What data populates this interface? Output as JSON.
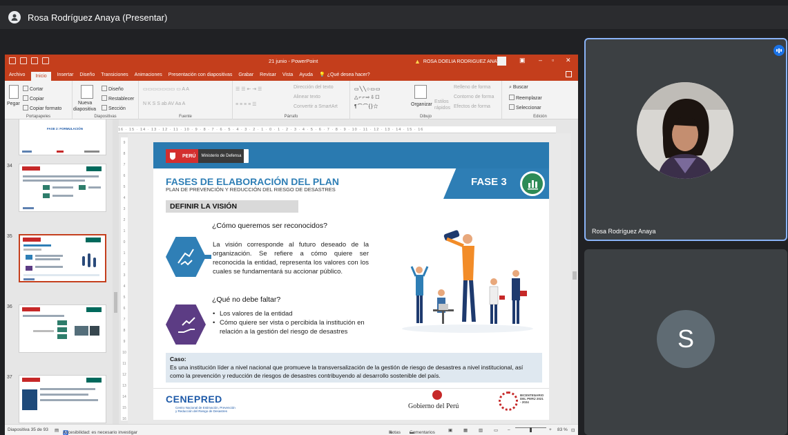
{
  "meeting": {
    "presenter_label": "Rosa Rodríguez Anaya (Presentar)"
  },
  "ppt": {
    "doc_title": "21 junio  -  PowerPoint",
    "user_name": "ROSA DOELIA RODRIGUEZ ANAYA",
    "tabs": [
      "Archivo",
      "Inicio",
      "Insertar",
      "Diseño",
      "Transiciones",
      "Animaciones",
      "Presentación con diapositivas",
      "Grabar",
      "Revisar",
      "Vista",
      "Ayuda"
    ],
    "help_search": "¿Qué desea hacer?",
    "ribbon": {
      "cut": "Cortar",
      "copy": "Copiar",
      "paste": "Pegar",
      "format_painter": "Copiar formato",
      "clipboard_group": "Portapapeles",
      "new_slide_1": "Nueva",
      "new_slide_2": "diapositiva",
      "layout": "Diseño",
      "reset": "Restablecer",
      "section": "Sección",
      "slides_group": "Diapositivas",
      "font_group": "Fuente",
      "paragraph_group": "Párrafo",
      "text_direction": "Dirección del texto",
      "align_text": "Alinear texto",
      "smartart": "Convertir a SmartArt",
      "arrange": "Organizar",
      "quick_styles_1": "Estilos",
      "quick_styles_2": "rápidos",
      "shape_fill": "Relleno de forma",
      "shape_outline": "Contorno de forma",
      "shape_effects": "Efectos de forma",
      "drawing_group": "Dibujo",
      "find": "Buscar",
      "replace": "Reemplazar",
      "select": "Seleccionar",
      "editing_group": "Edición"
    },
    "ruler_text": "16 · 15 · 14 · 13 · 12 · 11 · 10 · 9 · 8 · 7 · 6 · 5 · 4 · 3 · 2 · 1 · 0 · 1 · 2 · 3 · 4 · 5 · 6 · 7 · 8 · 9 · 10 · 11 · 12 · 13 · 14 · 15 · 16",
    "thumbs": [
      {
        "num": "",
        "caption": "FASE 2: FORMULACIÓN"
      },
      {
        "num": "34",
        "caption": ""
      },
      {
        "num": "35",
        "caption": ""
      },
      {
        "num": "36",
        "caption": ""
      },
      {
        "num": "37",
        "caption": ""
      }
    ],
    "status": {
      "slide_count": "Diapositiva 35 de 93",
      "accessibility": "Accesibilidad: es necesario investigar",
      "notes": "Notas",
      "comments": "Comentarios",
      "zoom": "83 %"
    }
  },
  "slide": {
    "peru": "PERÚ",
    "ministry": "Ministerio de Defensa",
    "phase": "FASE 3",
    "title": "FASES DE ELABORACIÓN DEL PLAN",
    "subtitle": "PLAN DE PREVENCIÓN Y REDUCCIÓN DEL RIESGO DE DESASTRES",
    "section": "DEFINIR LA VISIÓN",
    "q1": "¿Cómo queremos ser reconocidos?",
    "p1": "La visión corresponde al futuro deseado de la organización. Se refiere a cómo quiere ser reconocida la entidad, representa los valores con los cuales se fundamentará su accionar público.",
    "q2": "¿Qué no debe faltar?",
    "bullets": [
      "Los valores de la entidad",
      "Cómo quiere ser vista o percibida la institución en relación a la gestión del riesgo de desastres"
    ],
    "caso_label": "Caso:",
    "caso_text": "Es una institución líder a nivel nacional que promueve la transversalización de la gestión de riesgo de desastres a nivel institucional, así como la prevención y reducción de riesgos de desastres contribuyendo al desarrollo sostenible del país.",
    "footer_left": "CENEPRED",
    "footer_left_sub": "Centro Nacional de Estimación, Prevención y Reducción del Riesgo de Desastres",
    "footer_mid": "Gobierno del Perú",
    "footer_right": "BICENTENARIO DEL PERÚ 2021 - 2024"
  },
  "participants": [
    {
      "name": "Rosa Rodríguez Anaya"
    },
    {
      "name": "",
      "initial": "S"
    }
  ],
  "colors": {
    "ppt_accent": "#c43e1c",
    "meet_bg": "#202124",
    "tile_bg": "#3c4043",
    "speaking": "#8ab4f8",
    "slide_blue": "#2e7eb5",
    "slide_purple": "#5c3c84"
  }
}
